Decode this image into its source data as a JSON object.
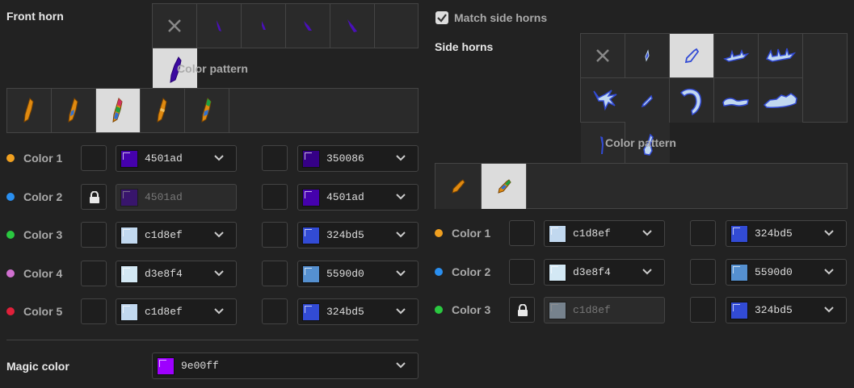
{
  "front_horn": {
    "title": "Front horn",
    "pattern_title": "Color pattern",
    "colors": [
      {
        "label": "Color 1",
        "dot": "#f0a020",
        "locked": false,
        "a_hex": "4501ad",
        "a_color": "#4501ad",
        "a_disabled": false,
        "b_hex": "350086",
        "b_color": "#350086"
      },
      {
        "label": "Color 2",
        "dot": "#2a8ff0",
        "locked": true,
        "a_hex": "4501ad",
        "a_color": "#4501ad",
        "a_disabled": true,
        "b_hex": "4501ad",
        "b_color": "#4501ad"
      },
      {
        "label": "Color 3",
        "dot": "#2ac840",
        "locked": false,
        "a_hex": "c1d8ef",
        "a_color": "#c1d8ef",
        "a_disabled": false,
        "b_hex": "324bd5",
        "b_color": "#324bd5"
      },
      {
        "label": "Color 4",
        "dot": "#d070d0",
        "locked": false,
        "a_hex": "d3e8f4",
        "a_color": "#d3e8f4",
        "a_disabled": false,
        "b_hex": "5590d0",
        "b_color": "#5590d0"
      },
      {
        "label": "Color 5",
        "dot": "#e0203a",
        "locked": false,
        "a_hex": "c1d8ef",
        "a_color": "#c1d8ef",
        "a_disabled": false,
        "b_hex": "324bd5",
        "b_color": "#324bd5"
      }
    ]
  },
  "magic": {
    "label": "Magic color",
    "hex": "9e00ff",
    "color": "#9e00ff"
  },
  "side_horns": {
    "match_label": "Match side horns",
    "match_checked": true,
    "title": "Side horns",
    "pattern_title": "Color pattern",
    "colors": [
      {
        "label": "Color 1",
        "dot": "#f0a020",
        "locked": false,
        "a_hex": "c1d8ef",
        "a_color": "#c1d8ef",
        "a_disabled": false,
        "b_hex": "324bd5",
        "b_color": "#324bd5"
      },
      {
        "label": "Color 2",
        "dot": "#2a8ff0",
        "locked": false,
        "a_hex": "d3e8f4",
        "a_color": "#d3e8f4",
        "a_disabled": false,
        "b_hex": "5590d0",
        "b_color": "#5590d0"
      },
      {
        "label": "Color 3",
        "dot": "#2ac840",
        "locked": true,
        "a_hex": "c1d8ef",
        "a_color": "#c1d8ef",
        "a_disabled": true,
        "b_hex": "324bd5",
        "b_color": "#324bd5"
      }
    ]
  }
}
